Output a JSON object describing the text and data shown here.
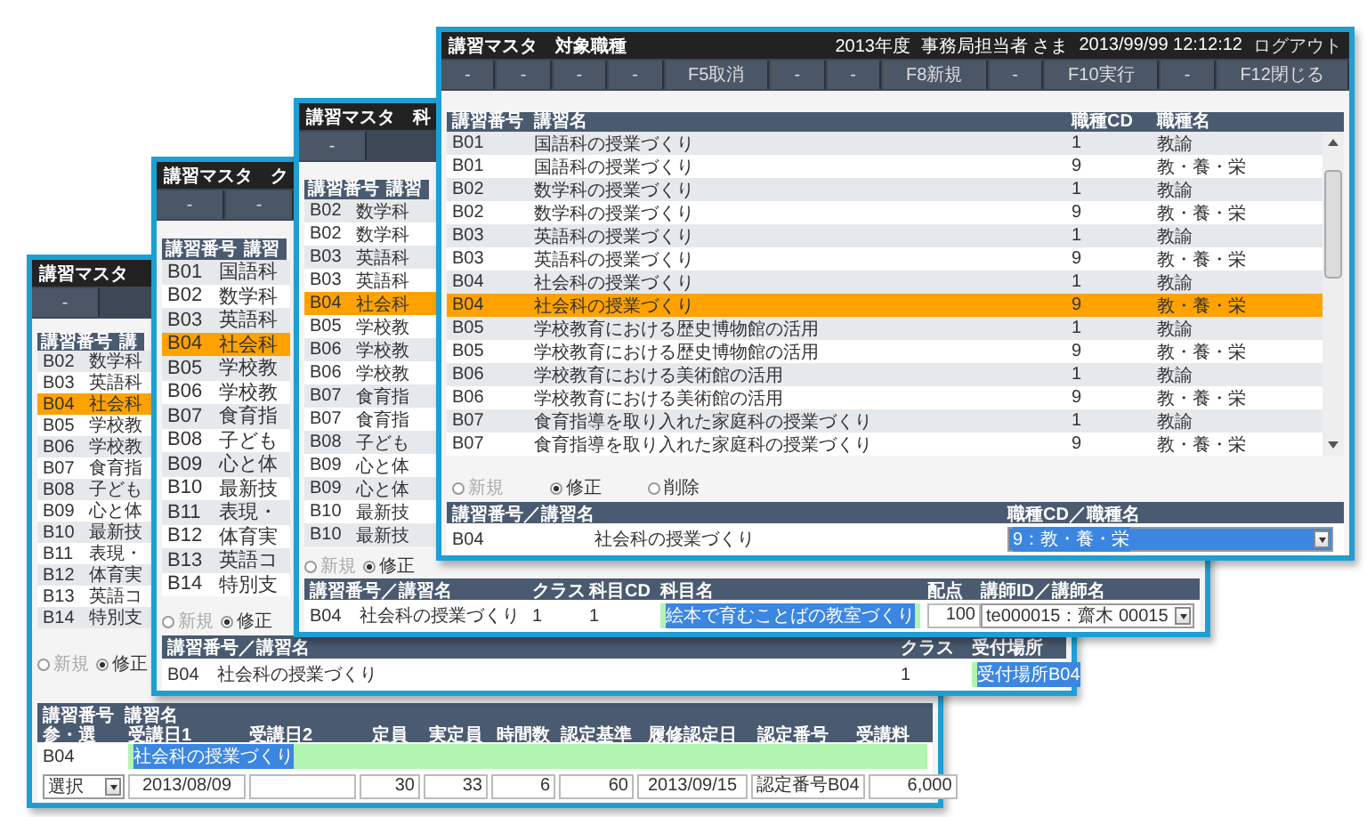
{
  "windows": [
    {
      "kind": "job",
      "title": "講習マスタ",
      "subtitle": "対象職種",
      "info": [
        "2013年度",
        "事務局担当者 さま",
        "2013/99/99 12:12:12"
      ],
      "logout": "ログアウト",
      "fkeys": [
        "-",
        "-",
        "-",
        "-",
        "F5取消",
        "-",
        "-",
        "F8新規",
        "-",
        "F10実行",
        "-",
        "F12閉じる"
      ],
      "columns": [
        "講習番号",
        "講習名",
        "職種CD",
        "職種名"
      ],
      "rows": [
        {
          "code": "B01",
          "name": "国語科の授業づくり",
          "cd": "1",
          "type": "教諭",
          "selected": false
        },
        {
          "code": "B01",
          "name": "国語科の授業づくり",
          "cd": "9",
          "type": "教・養・栄",
          "selected": false
        },
        {
          "code": "B02",
          "name": "数学科の授業づくり",
          "cd": "1",
          "type": "教諭",
          "selected": false
        },
        {
          "code": "B02",
          "name": "数学科の授業づくり",
          "cd": "9",
          "type": "教・養・栄",
          "selected": false
        },
        {
          "code": "B03",
          "name": "英語科の授業づくり",
          "cd": "1",
          "type": "教諭",
          "selected": false
        },
        {
          "code": "B03",
          "name": "英語科の授業づくり",
          "cd": "9",
          "type": "教・養・栄",
          "selected": false
        },
        {
          "code": "B04",
          "name": "社会科の授業づくり",
          "cd": "1",
          "type": "教諭",
          "selected": false
        },
        {
          "code": "B04",
          "name": "社会科の授業づくり",
          "cd": "9",
          "type": "教・養・栄",
          "selected": true
        },
        {
          "code": "B05",
          "name": "学校教育における歴史博物館の活用",
          "cd": "1",
          "type": "教諭",
          "selected": false
        },
        {
          "code": "B05",
          "name": "学校教育における歴史博物館の活用",
          "cd": "9",
          "type": "教・養・栄",
          "selected": false
        },
        {
          "code": "B06",
          "name": "学校教育における美術館の活用",
          "cd": "1",
          "type": "教諭",
          "selected": false
        },
        {
          "code": "B06",
          "name": "学校教育における美術館の活用",
          "cd": "9",
          "type": "教・養・栄",
          "selected": false
        },
        {
          "code": "B07",
          "name": "食育指導を取り入れた家庭科の授業づくり",
          "cd": "1",
          "type": "教諭",
          "selected": false
        },
        {
          "code": "B07",
          "name": "食育指導を取り入れた家庭科の授業づくり",
          "cd": "9",
          "type": "教・養・栄",
          "selected": false
        }
      ],
      "radios": [
        {
          "label": "新規",
          "selected": false,
          "disabled": true
        },
        {
          "label": "修正",
          "selected": true,
          "disabled": false
        },
        {
          "label": "削除",
          "selected": false,
          "disabled": false
        }
      ],
      "form": {
        "headers": [
          "講習番号／講習名",
          "職種CD／職種名"
        ],
        "code": "B04",
        "name": "社会科の授業づくり",
        "job": "9：教・養・栄"
      }
    },
    {
      "kind": "subject",
      "title": "講習マスタ",
      "subtitle": "科",
      "fkeys": [
        "-"
      ],
      "columns": [
        "講習番号",
        "講習"
      ],
      "rows": [
        {
          "code": "B02",
          "name": "数学科",
          "selected": false
        },
        {
          "code": "B02",
          "name": "数学科",
          "selected": false
        },
        {
          "code": "B03",
          "name": "英語科",
          "selected": false
        },
        {
          "code": "B03",
          "name": "英語科",
          "selected": false
        },
        {
          "code": "B04",
          "name": "社会科",
          "selected": true
        },
        {
          "code": "B05",
          "name": "学校教",
          "selected": false
        },
        {
          "code": "B06",
          "name": "学校教",
          "selected": false
        },
        {
          "code": "B06",
          "name": "学校教",
          "selected": false
        },
        {
          "code": "B07",
          "name": "食育指",
          "selected": false
        },
        {
          "code": "B07",
          "name": "食育指",
          "selected": false
        },
        {
          "code": "B08",
          "name": "子ども",
          "selected": false
        },
        {
          "code": "B09",
          "name": "心と体",
          "selected": false
        },
        {
          "code": "B09",
          "name": "心と体",
          "selected": false
        },
        {
          "code": "B10",
          "name": "最新技",
          "selected": false
        },
        {
          "code": "B10",
          "name": "最新技",
          "selected": false
        }
      ],
      "radios": [
        {
          "label": "新規",
          "selected": false,
          "disabled": true
        },
        {
          "label": "修正",
          "selected": true,
          "disabled": false
        }
      ],
      "form": {
        "headers": [
          "講習番号／講習名",
          "クラス",
          "科目CD",
          "科目名",
          "配点",
          "講師ID／講師名"
        ],
        "code": "B04",
        "name": "社会科の授業づくり",
        "class_no": "1",
        "subject_cd": "1",
        "subject": "絵本で育むことばの教室づくり",
        "points": "100",
        "teacher": "te000015：齋木 00015"
      }
    },
    {
      "kind": "class",
      "title": "講習マスタ",
      "subtitle": "ク",
      "fkeys": [
        "-",
        "-"
      ],
      "columns": [
        "講習番号",
        "講習"
      ],
      "rows": [
        {
          "code": "B01",
          "name": "国語科",
          "selected": false
        },
        {
          "code": "B02",
          "name": "数学科",
          "selected": false
        },
        {
          "code": "B03",
          "name": "英語科",
          "selected": false
        },
        {
          "code": "B04",
          "name": "社会科",
          "selected": true
        },
        {
          "code": "B05",
          "name": "学校教",
          "selected": false
        },
        {
          "code": "B06",
          "name": "学校教",
          "selected": false
        },
        {
          "code": "B07",
          "name": "食育指",
          "selected": false
        },
        {
          "code": "B08",
          "name": "子ども",
          "selected": false
        },
        {
          "code": "B09",
          "name": "心と体",
          "selected": false
        },
        {
          "code": "B10",
          "name": "最新技",
          "selected": false
        },
        {
          "code": "B11",
          "name": "表現・",
          "selected": false
        },
        {
          "code": "B12",
          "name": "体育実",
          "selected": false
        },
        {
          "code": "B13",
          "name": "英語コ",
          "selected": false
        },
        {
          "code": "B14",
          "name": "特別支",
          "selected": false
        }
      ],
      "radios": [
        {
          "label": "新規",
          "selected": false,
          "disabled": true
        },
        {
          "label": "修正",
          "selected": true,
          "disabled": false
        }
      ],
      "form": {
        "headers": [
          "講習番号／講習名",
          "クラス",
          "受付場所"
        ],
        "code": "B04",
        "name": "社会科の授業づくり",
        "class_no": "1",
        "place": "受付場所B04"
      }
    },
    {
      "kind": "course",
      "title": "講習マスタ",
      "fkeys": [
        "-"
      ],
      "columns": [
        "講習番号",
        "講"
      ],
      "rows": [
        {
          "code": "B02",
          "name": "数学科",
          "selected": false
        },
        {
          "code": "B03",
          "name": "英語科",
          "selected": false
        },
        {
          "code": "B04",
          "name": "社会科",
          "selected": true
        },
        {
          "code": "B05",
          "name": "学校教",
          "selected": false
        },
        {
          "code": "B06",
          "name": "学校教",
          "selected": false
        },
        {
          "code": "B07",
          "name": "食育指",
          "selected": false
        },
        {
          "code": "B08",
          "name": "子ども",
          "selected": false
        },
        {
          "code": "B09",
          "name": "心と体",
          "selected": false
        },
        {
          "code": "B10",
          "name": "最新技",
          "selected": false
        },
        {
          "code": "B11",
          "name": "表現・",
          "selected": false
        },
        {
          "code": "B12",
          "name": "体育実",
          "selected": false
        },
        {
          "code": "B13",
          "name": "英語コ",
          "selected": false
        },
        {
          "code": "B14",
          "name": "特別支",
          "selected": false
        }
      ],
      "radios": [
        {
          "label": "新規",
          "selected": false,
          "disabled": true
        },
        {
          "label": "修正",
          "selected": true,
          "disabled": false
        }
      ],
      "form": {
        "header_top": [
          "講習番号",
          "講習名"
        ],
        "headers": [
          "参・選",
          "受講日1",
          "受講日2",
          "定員",
          "実定員",
          "時間数",
          "認定基準",
          "履修認定日",
          "認定番号",
          "受講料"
        ],
        "code": "B04",
        "name": "社会科の授業づくり",
        "select": "選択",
        "fields": [
          {
            "kind": "date",
            "value": "2013/08/09"
          },
          {
            "kind": "date"
          },
          {
            "kind": "number",
            "value": "30"
          },
          {
            "kind": "number",
            "value": "33"
          },
          {
            "kind": "number",
            "value": "6"
          },
          {
            "kind": "number",
            "value": "60"
          },
          {
            "kind": "date",
            "value": "2013/09/15"
          },
          {
            "kind": "text",
            "value": "認定番号B04"
          },
          {
            "kind": "number",
            "value": "6,000"
          }
        ]
      }
    }
  ]
}
